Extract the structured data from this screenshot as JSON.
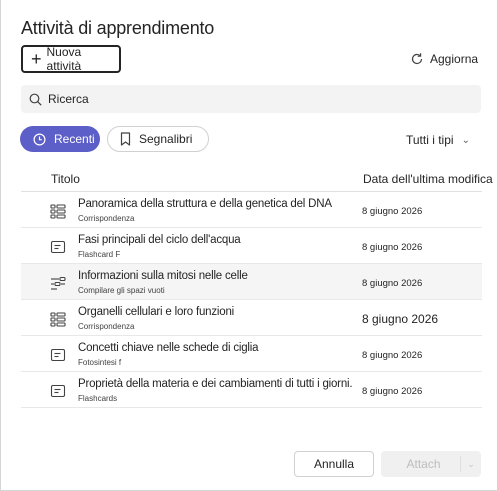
{
  "header": {
    "title": "Attività di apprendimento"
  },
  "toolbar": {
    "new_label": "Nuova attività",
    "refresh_label": "Aggiorna"
  },
  "search": {
    "placeholder": "Ricerca"
  },
  "filters": {
    "recent_label": "Recenti",
    "bookmarks_label": "Segnalibri",
    "types_label": "Tutti i tipi"
  },
  "table": {
    "col_title": "Titolo",
    "col_date": "Data dell'ultima modifica",
    "rows": [
      {
        "icon": "grid-icon",
        "name": "Panoramica della struttura e della genetica del DNA",
        "sub": "Corrispondenza",
        "date": "8 giugno 2026"
      },
      {
        "icon": "flashcard-icon",
        "name": "Fasi principali del ciclo dell'acqua",
        "sub": "Flashcard F",
        "date": "8 giugno 2026"
      },
      {
        "icon": "fill-blanks-icon",
        "name": "Informazioni sulla mitosi nelle celle",
        "sub": "Compilare gli spazi vuoti",
        "date": "8 giugno 2026"
      },
      {
        "icon": "grid-icon",
        "name": "Organelli cellulari e loro funzioni",
        "sub": "Corrispondenza",
        "date": "8 giugno 2026"
      },
      {
        "icon": "flashcard-icon",
        "name": "Concetti chiave nelle schede di ciglia",
        "sub": "Fotosintesi f",
        "date": "8 giugno 2026"
      },
      {
        "icon": "flashcard-icon",
        "name": "Proprietà della materia e dei cambiamenti di tutti i giorni.",
        "sub": "Flashcards",
        "date": "8 giugno 2026"
      }
    ]
  },
  "footer": {
    "cancel_label": "Annulla",
    "attach_label": "Attach"
  },
  "colors": {
    "accent": "#5b5fc7",
    "text": "#242424",
    "row_highlight": "#f5f5f5"
  }
}
